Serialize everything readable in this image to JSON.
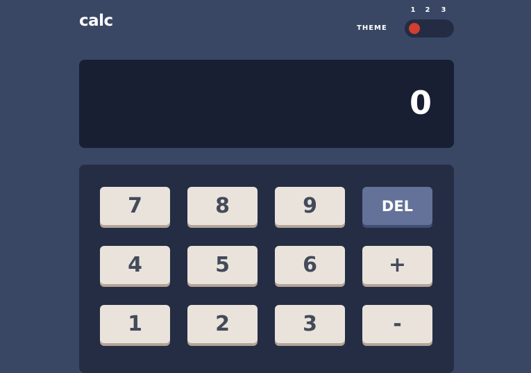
{
  "header": {
    "logo": "calc",
    "theme_label": "THEME",
    "theme_options": [
      "1",
      "2",
      "3"
    ],
    "selected_theme": 1,
    "colors": {
      "background": "#3a4764",
      "toggle_track": "#232c43",
      "toggle_knob": "#d03f2f"
    }
  },
  "screen": {
    "value": "0",
    "color": "#181f33"
  },
  "keypad": {
    "rows": [
      [
        "7",
        "8",
        "9",
        "DEL"
      ],
      [
        "4",
        "5",
        "6",
        "+"
      ],
      [
        "1",
        "2",
        "3",
        "-"
      ]
    ],
    "colors": {
      "panel": "#242d44",
      "key": "#eae3dc",
      "key_shadow": "#b3a497",
      "key_text": "#434a59",
      "del_key": "#647198",
      "del_shadow": "#414e73"
    }
  }
}
